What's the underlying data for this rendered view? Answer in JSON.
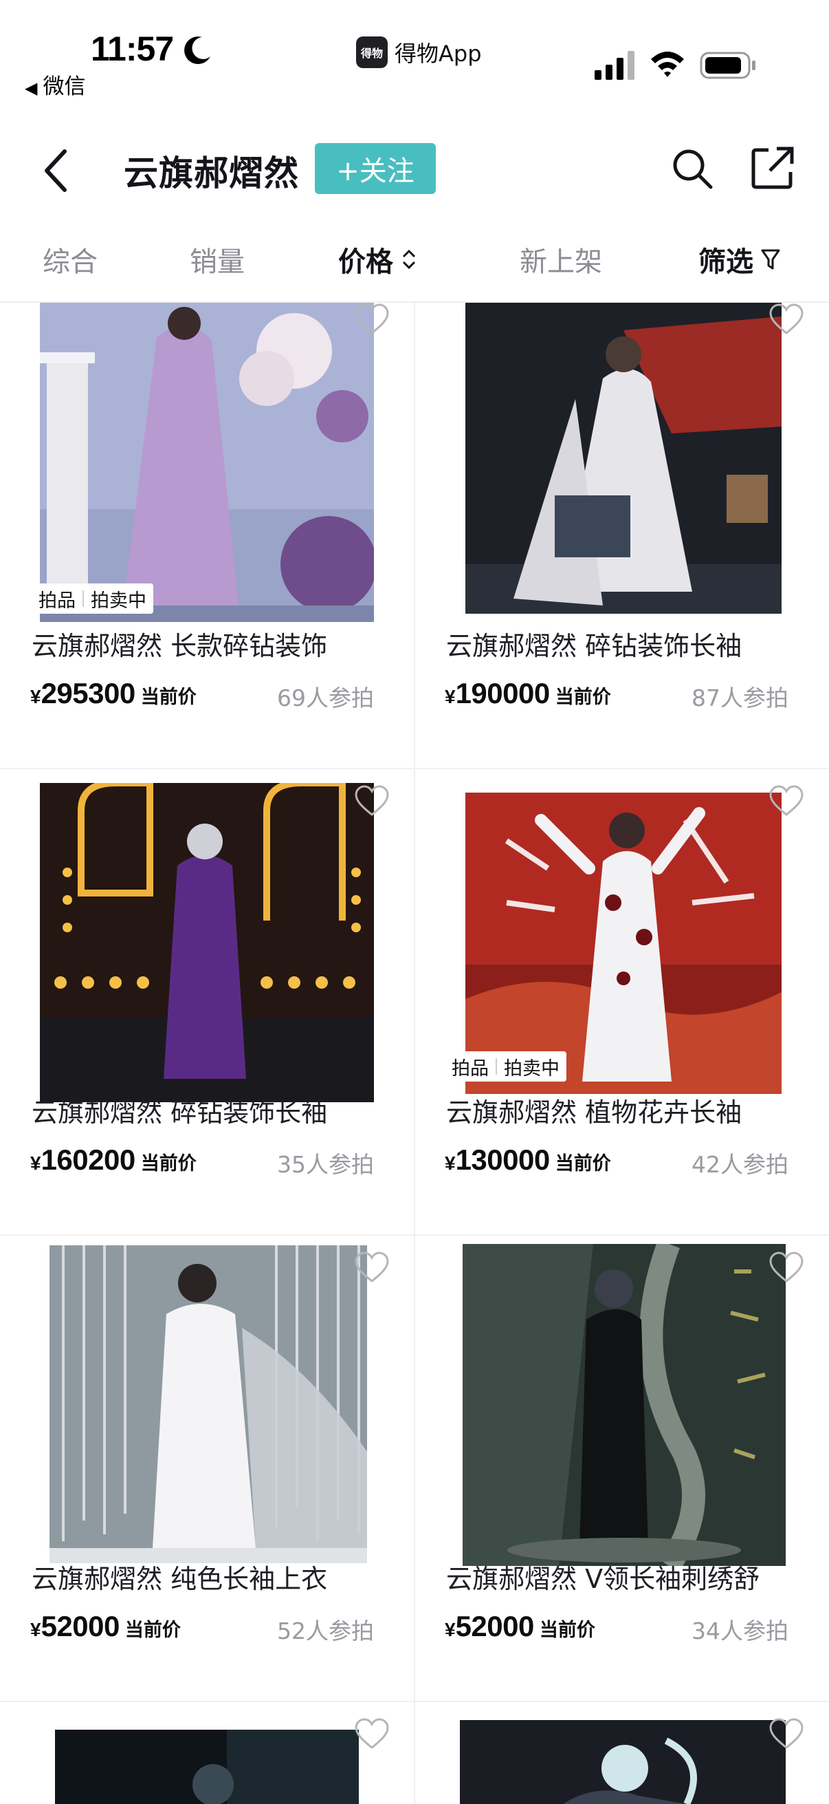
{
  "status_bar": {
    "time": "11:57",
    "back_app": "微信",
    "app_name": "得物App",
    "app_logo_text": "得物"
  },
  "nav": {
    "title": "云旗郝熠然",
    "follow_label": "+关注"
  },
  "sort_tabs": [
    {
      "label": "综合",
      "active": false
    },
    {
      "label": "销量",
      "active": false
    },
    {
      "label": "价格",
      "active": true
    },
    {
      "label": "新上架",
      "active": false
    },
    {
      "label": "筛选",
      "active": true
    }
  ],
  "products": [
    {
      "title": "云旗郝熠然 长款碎钻装饰",
      "currency": "¥",
      "price": "295300",
      "price_label": "当前价",
      "bidders": "69人参拍",
      "badge": [
        "拍品",
        "拍卖中"
      ],
      "palette": [
        "#aab3d6",
        "#b79ad0",
        "#6f4c8c"
      ]
    },
    {
      "title": "云旗郝熠然 碎钻装饰长袖",
      "currency": "¥",
      "price": "190000",
      "price_label": "当前价",
      "bidders": "87人参拍",
      "badge": null,
      "palette": [
        "#1e2027",
        "#e6e6ea",
        "#9c2a25"
      ]
    },
    {
      "title": "云旗郝熠然 碎钻装饰长袖",
      "currency": "¥",
      "price": "160200",
      "price_label": "当前价",
      "bidders": "35人参拍",
      "badge": null,
      "palette": [
        "#241612",
        "#5a2b86",
        "#f5c048"
      ]
    },
    {
      "title": "云旗郝熠然 植物花卉长袖",
      "currency": "¥",
      "price": "130000",
      "price_label": "当前价",
      "bidders": "42人参拍",
      "badge": [
        "拍品",
        "拍卖中"
      ],
      "palette": [
        "#b02a22",
        "#f2f2f4",
        "#6e1016"
      ]
    },
    {
      "title": "云旗郝熠然 纯色长袖上衣",
      "currency": "¥",
      "price": "52000",
      "price_label": "当前价",
      "bidders": "52人参拍",
      "badge": null,
      "palette": [
        "#8f9aa0",
        "#f4f4f6",
        "#c9ced3"
      ]
    },
    {
      "title": "云旗郝熠然 V领长袖刺绣舒",
      "currency": "¥",
      "price": "52000",
      "price_label": "当前价",
      "bidders": "34人参拍",
      "badge": null,
      "palette": [
        "#2b3733",
        "#111214",
        "#7e8a82"
      ]
    },
    {
      "title": "",
      "currency": "",
      "price": "",
      "price_label": "",
      "bidders": "",
      "badge": null,
      "palette": [
        "#0f1418",
        "#1c2830",
        "#3a4a55"
      ]
    },
    {
      "title": "",
      "currency": "",
      "price": "",
      "price_label": "",
      "bidders": "",
      "badge": null,
      "palette": [
        "#1a1d24",
        "#cfe6ea",
        "#3a4150"
      ]
    }
  ],
  "colors": {
    "accent": "#49bec0",
    "text_primary": "#14151a",
    "text_secondary": "#9a9aa2"
  }
}
